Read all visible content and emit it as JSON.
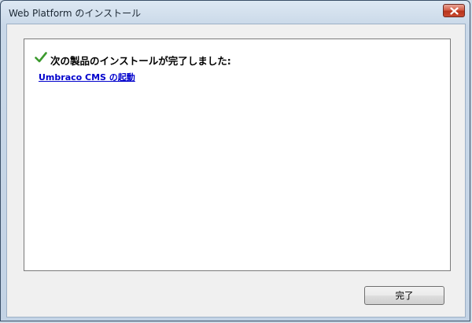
{
  "window": {
    "title": "Web Platform のインストール"
  },
  "content": {
    "heading": "次の製品のインストールが完了しました:",
    "link_text": "Umbraco CMS の起動",
    "status_icon": "checkmark-icon",
    "status_color": "#3c9a2e"
  },
  "footer": {
    "finish_label": "完了"
  },
  "colors": {
    "link": "#0000cc",
    "close_button": "#c9492f",
    "window_frame": "#c3d3e5"
  }
}
